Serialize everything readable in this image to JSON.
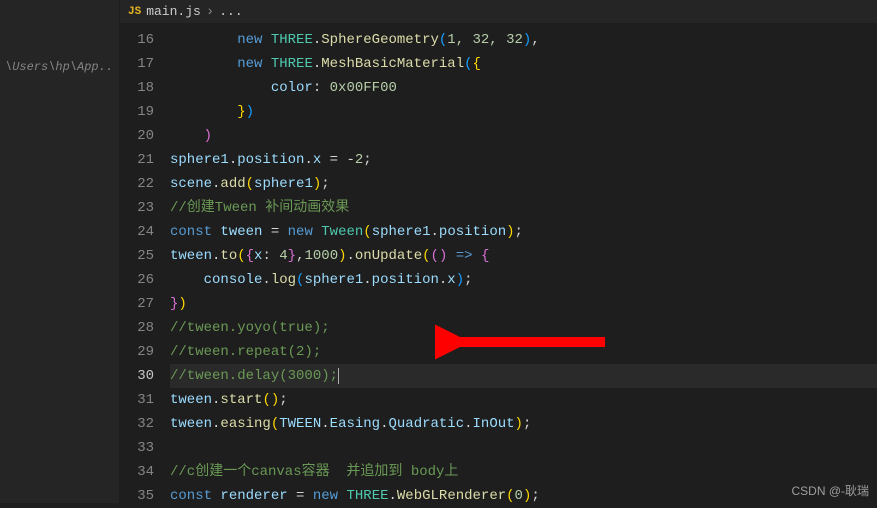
{
  "sidebar": {
    "path": "\\Users\\hp\\App..."
  },
  "tab": {
    "icon": "JS",
    "name": "main.js",
    "breadcrumb": "..."
  },
  "lines": {
    "start": 16,
    "current": 30,
    "l16": {
      "kw": "new",
      "cls": "THREE",
      "prop": "SphereGeometry",
      "args": "1, 32, 32"
    },
    "l17": {
      "kw": "new",
      "cls": "THREE",
      "prop": "MeshBasicMaterial"
    },
    "l18": {
      "prop": "color",
      "val": "0x00FF00"
    },
    "l21": {
      "v1": "sphere1",
      "p1": "position",
      "p2": "x",
      "val": "-2"
    },
    "l22": {
      "v1": "scene",
      "fn": "add",
      "arg": "sphere1"
    },
    "l23": {
      "cmt": "//创建Tween 补间动画效果"
    },
    "l24": {
      "kw": "const",
      "v": "tween",
      "kw2": "new",
      "cls": "Tween",
      "arg": "sphere1",
      "p": "position"
    },
    "l25": {
      "v": "tween",
      "fn1": "to",
      "p": "x",
      "n1": "4",
      "n2": "1000",
      "fn2": "onUpdate"
    },
    "l26": {
      "v": "console",
      "fn": "log",
      "a1": "sphere1",
      "p1": "position",
      "p2": "x"
    },
    "l28": {
      "cmt": "//tween.yoyo(true);"
    },
    "l29": {
      "cmt": "//tween.repeat(2);"
    },
    "l30": {
      "cmt": "//tween.delay(3000);"
    },
    "l31": {
      "v": "tween",
      "fn": "start"
    },
    "l32": {
      "v": "tween",
      "fn": "easing",
      "a": "TWEEN",
      "p1": "Easing",
      "p2": "Quadratic",
      "p3": "InOut"
    },
    "l34": {
      "cmt": "//c创建一个canvas容器  并追加到 body上"
    },
    "l35": {
      "kw": "const",
      "v": "renderer",
      "kw2": "new",
      "cls": "THREE",
      "fn": "WebGLRenderer",
      "n": "0"
    }
  },
  "watermark": "CSDN @-耿瑞"
}
